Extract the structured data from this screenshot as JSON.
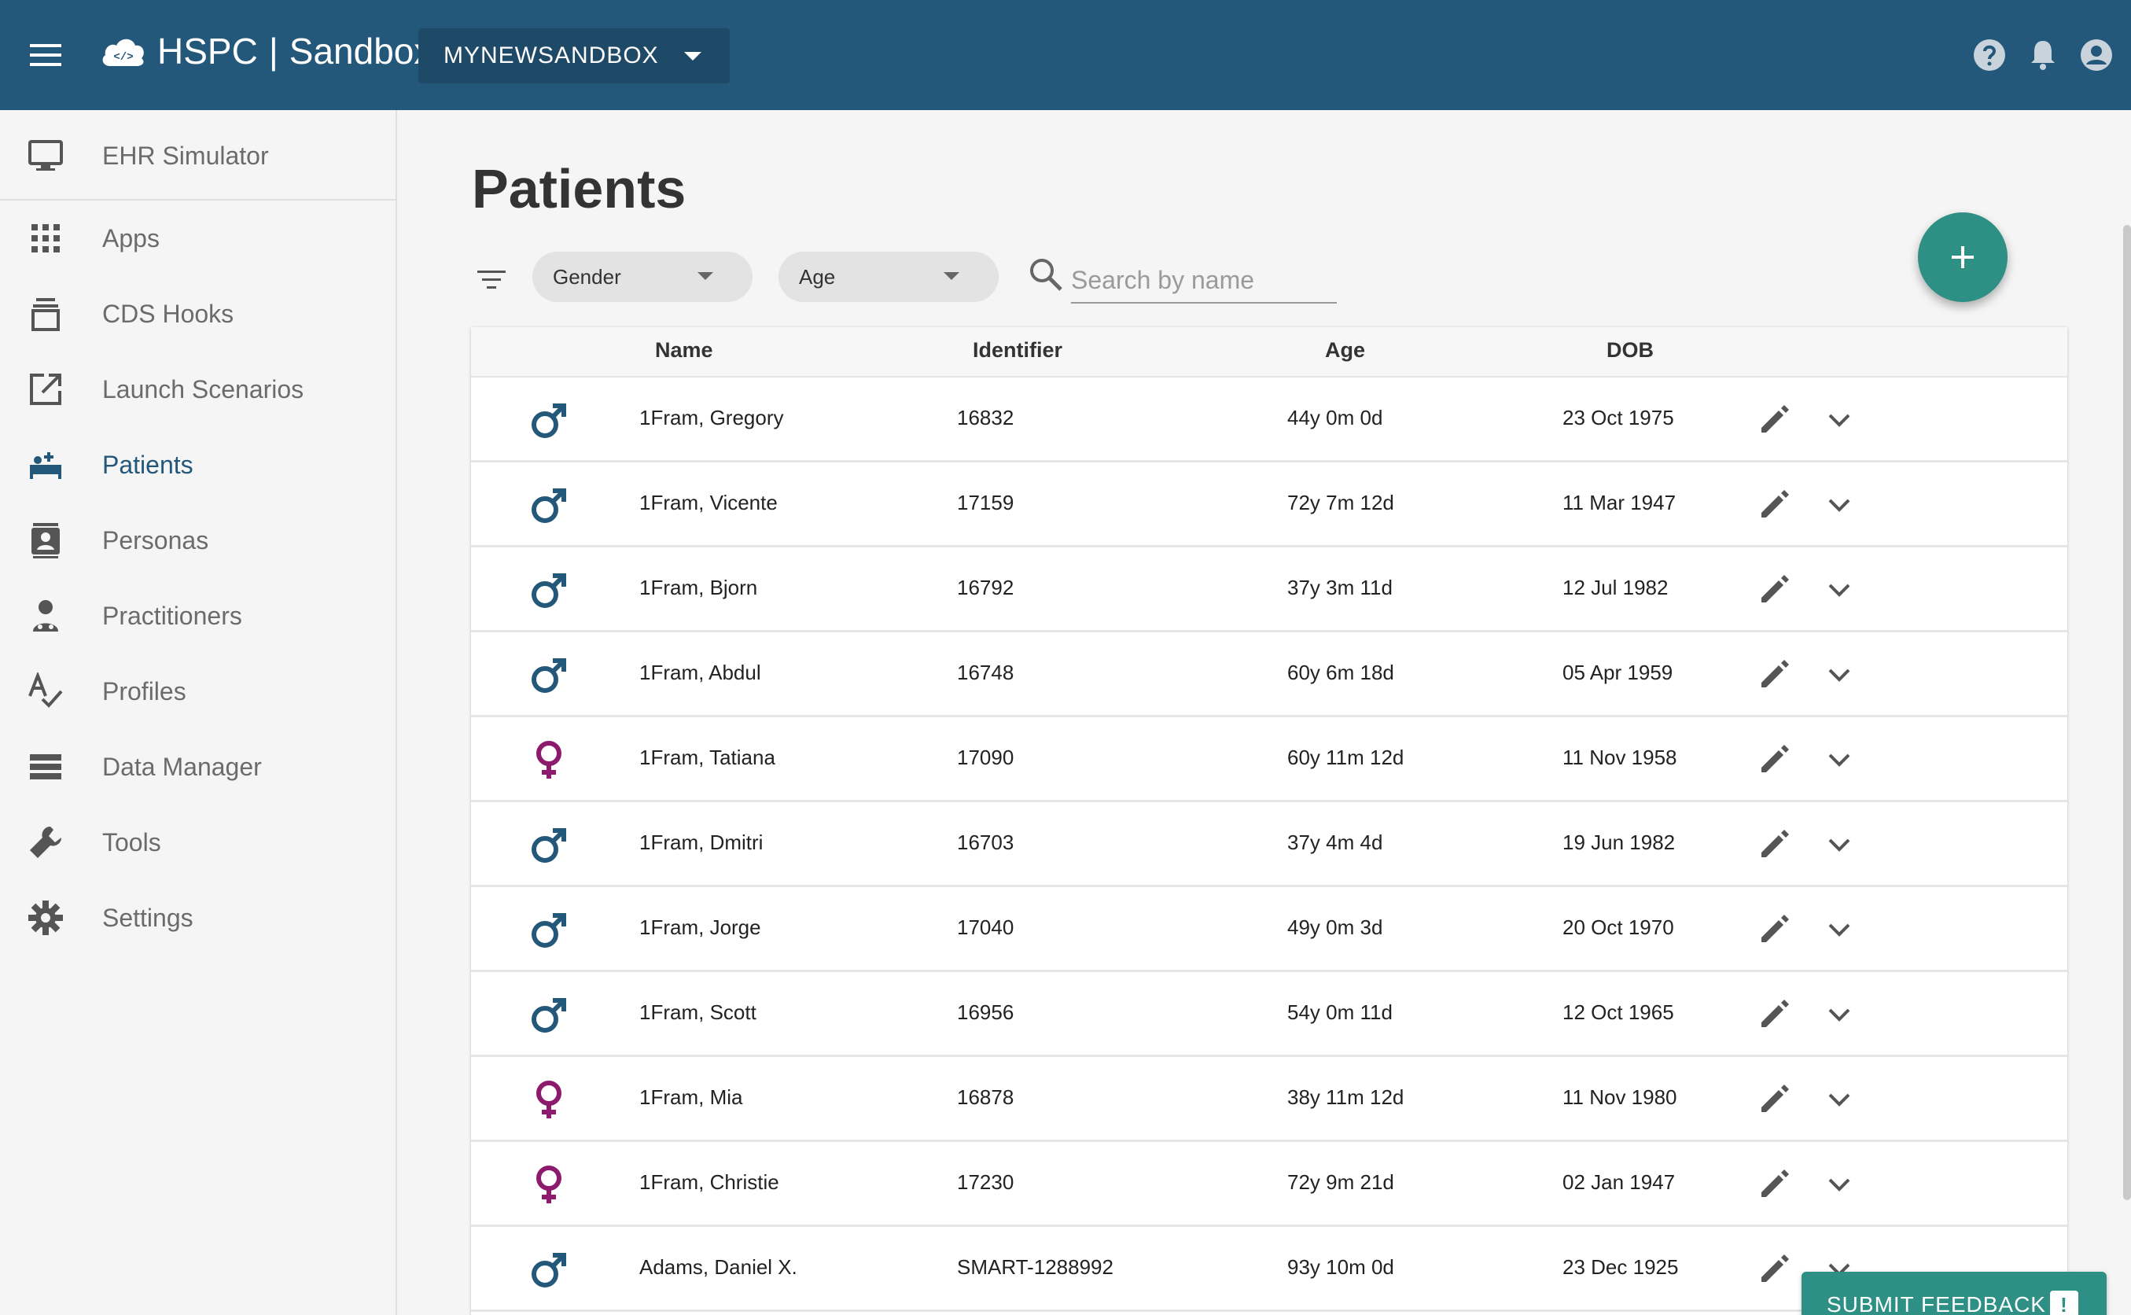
{
  "header": {
    "brand_left": "HSPC",
    "brand_right": "Sandbox",
    "sandbox_name": "MYNEWSANDBOX",
    "icons": [
      "help-icon",
      "bell-icon",
      "account-icon"
    ]
  },
  "sidebar": {
    "items": [
      {
        "label": "EHR Simulator",
        "icon": "monitor-icon"
      },
      {
        "label": "Apps",
        "icon": "apps-grid-icon"
      },
      {
        "label": "CDS Hooks",
        "icon": "hook-icon"
      },
      {
        "label": "Launch Scenarios",
        "icon": "launch-icon"
      },
      {
        "label": "Patients",
        "icon": "bed-icon",
        "active": true
      },
      {
        "label": "Personas",
        "icon": "contact-icon"
      },
      {
        "label": "Practitioners",
        "icon": "doctor-icon"
      },
      {
        "label": "Profiles",
        "icon": "spellcheck-icon"
      },
      {
        "label": "Data Manager",
        "icon": "storage-icon"
      },
      {
        "label": "Tools",
        "icon": "wrench-icon"
      },
      {
        "label": "Settings",
        "icon": "gear-icon"
      }
    ]
  },
  "main": {
    "title": "Patients",
    "filters": {
      "gender": "Gender",
      "age": "Age"
    },
    "search": {
      "placeholder": "Search by name",
      "value": ""
    }
  },
  "table": {
    "columns": [
      "Name",
      "Identifier",
      "Age",
      "DOB"
    ],
    "rows": [
      {
        "gender": "male",
        "name": "1Fram, Gregory",
        "identifier": "16832",
        "age": "44y 0m 0d",
        "dob": "23 Oct 1975"
      },
      {
        "gender": "male",
        "name": "1Fram, Vicente",
        "identifier": "17159",
        "age": "72y 7m 12d",
        "dob": "11 Mar 1947"
      },
      {
        "gender": "male",
        "name": "1Fram, Bjorn",
        "identifier": "16792",
        "age": "37y 3m 11d",
        "dob": "12 Jul 1982"
      },
      {
        "gender": "male",
        "name": "1Fram, Abdul",
        "identifier": "16748",
        "age": "60y 6m 18d",
        "dob": "05 Apr 1959"
      },
      {
        "gender": "female",
        "name": "1Fram, Tatiana",
        "identifier": "17090",
        "age": "60y 11m 12d",
        "dob": "11 Nov 1958"
      },
      {
        "gender": "male",
        "name": "1Fram, Dmitri",
        "identifier": "16703",
        "age": "37y 4m 4d",
        "dob": "19 Jun 1982"
      },
      {
        "gender": "male",
        "name": "1Fram, Jorge",
        "identifier": "17040",
        "age": "49y 0m 3d",
        "dob": "20 Oct 1970"
      },
      {
        "gender": "male",
        "name": "1Fram, Scott",
        "identifier": "16956",
        "age": "54y 0m 11d",
        "dob": "12 Oct 1965"
      },
      {
        "gender": "female",
        "name": "1Fram, Mia",
        "identifier": "16878",
        "age": "38y 11m 12d",
        "dob": "11 Nov 1980"
      },
      {
        "gender": "female",
        "name": "1Fram, Christie",
        "identifier": "17230",
        "age": "72y 9m 21d",
        "dob": "02 Jan 1947"
      },
      {
        "gender": "male",
        "name": "Adams, Daniel X.",
        "identifier": "SMART-1288992",
        "age": "93y 10m 0d",
        "dob": "23 Dec 1925"
      }
    ]
  },
  "feedback": {
    "label": "SUBMIT FEEDBACK",
    "badge": "!"
  },
  "colors": {
    "primary": "#24587a",
    "accent": "#2e9085",
    "male": "#24587a",
    "female": "#8e1a6e"
  }
}
